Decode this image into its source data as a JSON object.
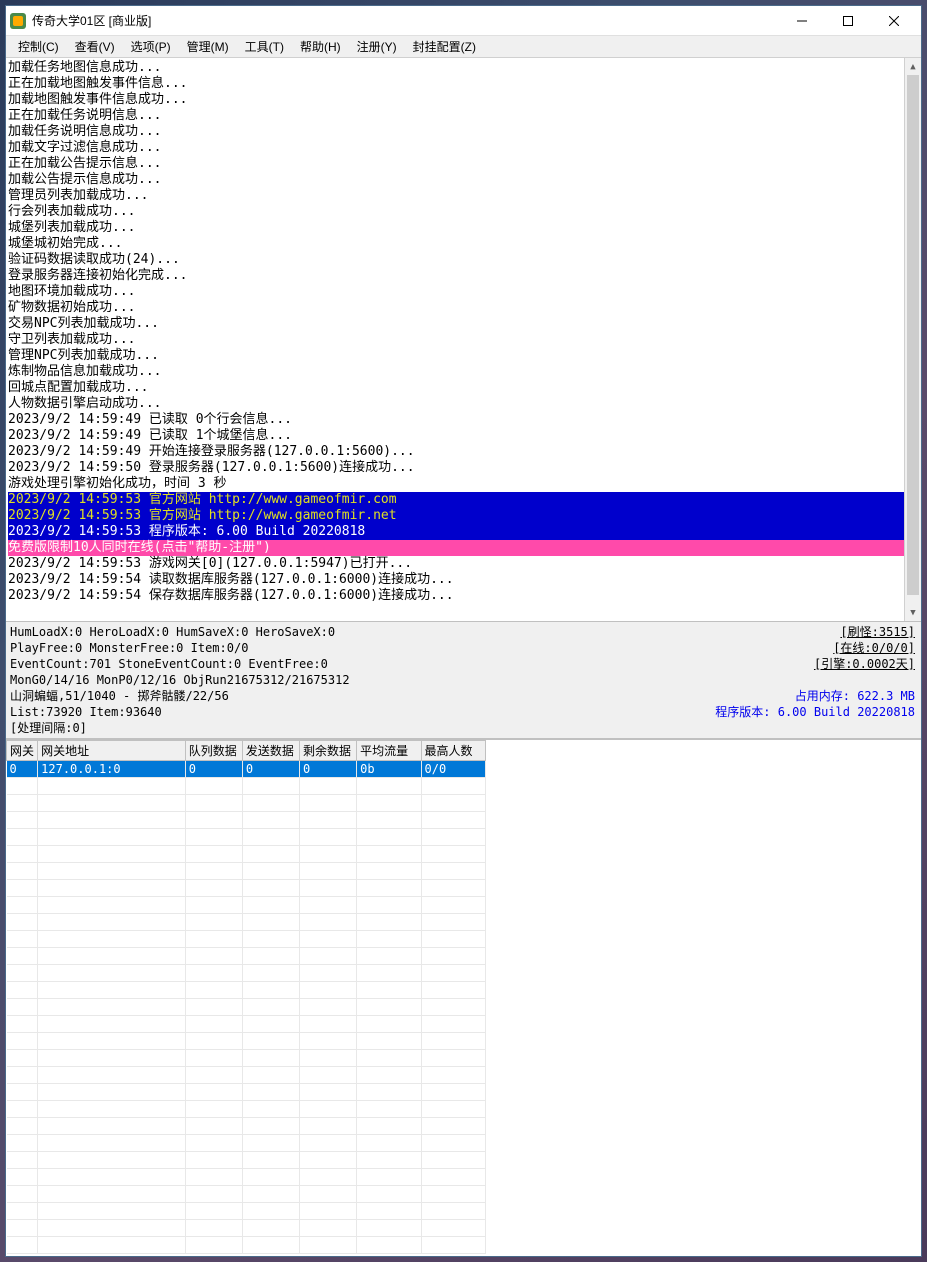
{
  "titlebar": {
    "title": "传奇大学01区 [商业版]"
  },
  "menu": {
    "items": [
      "控制(C)",
      "查看(V)",
      "选项(P)",
      "管理(M)",
      "工具(T)",
      "帮助(H)",
      "注册(Y)",
      "封挂配置(Z)"
    ]
  },
  "log": {
    "lines": [
      {
        "text": "加载任务地图信息成功...",
        "style": ""
      },
      {
        "text": "正在加载地图触发事件信息...",
        "style": ""
      },
      {
        "text": "加载地图触发事件信息成功...",
        "style": ""
      },
      {
        "text": "正在加载任务说明信息...",
        "style": ""
      },
      {
        "text": "加载任务说明信息成功...",
        "style": ""
      },
      {
        "text": "加载文字过滤信息成功...",
        "style": ""
      },
      {
        "text": "正在加载公告提示信息...",
        "style": ""
      },
      {
        "text": "加载公告提示信息成功...",
        "style": ""
      },
      {
        "text": "管理员列表加载成功...",
        "style": ""
      },
      {
        "text": "行会列表加载成功...",
        "style": ""
      },
      {
        "text": "城堡列表加载成功...",
        "style": ""
      },
      {
        "text": "城堡城初始完成...",
        "style": ""
      },
      {
        "text": "验证码数据读取成功(24)...",
        "style": ""
      },
      {
        "text": "登录服务器连接初始化完成...",
        "style": ""
      },
      {
        "text": "地图环境加载成功...",
        "style": ""
      },
      {
        "text": "矿物数据初始成功...",
        "style": ""
      },
      {
        "text": "交易NPC列表加载成功...",
        "style": ""
      },
      {
        "text": "守卫列表加载成功...",
        "style": ""
      },
      {
        "text": "管理NPC列表加载成功...",
        "style": ""
      },
      {
        "text": "炼制物品信息加载成功...",
        "style": ""
      },
      {
        "text": "回城点配置加载成功...",
        "style": ""
      },
      {
        "text": "人物数据引擎启动成功...",
        "style": ""
      },
      {
        "text": "2023/9/2 14:59:49 已读取 0个行会信息...",
        "style": ""
      },
      {
        "text": "2023/9/2 14:59:49 已读取 1个城堡信息...",
        "style": ""
      },
      {
        "text": "2023/9/2 14:59:49 开始连接登录服务器(127.0.0.1:5600)...",
        "style": ""
      },
      {
        "text": "2023/9/2 14:59:50 登录服务器(127.0.0.1:5600)连接成功...",
        "style": ""
      },
      {
        "text": "游戏处理引擎初始化成功，时间 3 秒",
        "style": ""
      },
      {
        "text": "2023/9/2 14:59:53 官方网站 http://www.gameofmir.com",
        "style": "hl-blue"
      },
      {
        "text": "2023/9/2 14:59:53 官方网站 http://www.gameofmir.net",
        "style": "hl-blue"
      },
      {
        "text": "2023/9/2 14:59:53 程序版本: 6.00 Build 20220818",
        "style": "hl-blue-white"
      },
      {
        "text": "免费版限制10人同时在线(点击\"帮助-注册\")",
        "style": "hl-pink"
      },
      {
        "text": "2023/9/2 14:59:53 游戏网关[0](127.0.0.1:5947)已打开...",
        "style": ""
      },
      {
        "text": "2023/9/2 14:59:54 读取数据库服务器(127.0.0.1:6000)连接成功...",
        "style": ""
      },
      {
        "text": "2023/9/2 14:59:54 保存数据库服务器(127.0.0.1:6000)连接成功...",
        "style": ""
      }
    ]
  },
  "stats": {
    "left": [
      "HumLoadX:0 HeroLoadX:0 HumSaveX:0 HeroSaveX:0",
      "PlayFree:0 MonsterFree:0 Item:0/0",
      "EventCount:701 StoneEventCount:0 EventFree:0",
      "MonG0/14/16 MonP0/12/16 ObjRun21675312/21675312",
      "山洞蝙蝠,51/1040 - 掷斧骷髅/22/56",
      "List:73920 Item:93640",
      "[处理间隔:0]"
    ],
    "right": {
      "r1": "[刷怪:3515]",
      "r2": "[在线:0/0/0]",
      "r3": "[引擎:0.0002天]",
      "mem": "占用内存: 622.3 MB",
      "ver": "程序版本: 6.00 Build 20220818"
    }
  },
  "table": {
    "headers": [
      "网关",
      "网关地址",
      "队列数据",
      "发送数据",
      "剩余数据",
      "平均流量",
      "最高人数"
    ],
    "row": [
      "0",
      "127.0.0.1:0",
      "0",
      "0",
      "0",
      "0b",
      "0/0"
    ],
    "empty_rows": 28
  }
}
